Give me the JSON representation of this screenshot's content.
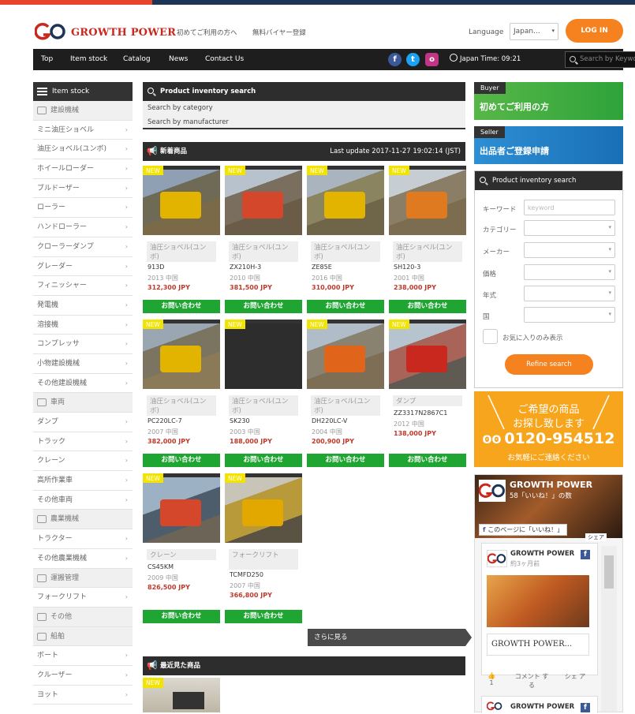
{
  "brand": {
    "name": "GROWTH POWER"
  },
  "header": {
    "links": [
      "初めてご利用の方へ",
      "無料バイヤー登録"
    ],
    "language_label": "Language",
    "language_value": "Japan...",
    "login": "LOG IN"
  },
  "nav": {
    "items": [
      "Top",
      "Item stock",
      "Catalog",
      "News",
      "Contact Us"
    ],
    "time_label": "Japan Time: 09:21",
    "search_placeholder": "Search by Keywor"
  },
  "social": [
    "f",
    "t",
    "o"
  ],
  "sidebar": {
    "title": "Item stock",
    "rows": [
      {
        "label": "建設機械",
        "type": "cat"
      },
      {
        "label": "ミニ油圧ショベル",
        "type": "item"
      },
      {
        "label": "油圧ショベル(ユンボ)",
        "type": "item"
      },
      {
        "label": "ホイールローダー",
        "type": "item"
      },
      {
        "label": "ブルドーザー",
        "type": "item"
      },
      {
        "label": "ローラー",
        "type": "item"
      },
      {
        "label": "ハンドローラー",
        "type": "item"
      },
      {
        "label": "クローラーダンプ",
        "type": "item"
      },
      {
        "label": "グレーダー",
        "type": "item"
      },
      {
        "label": "フィニッシャー",
        "type": "item"
      },
      {
        "label": "発電機",
        "type": "item"
      },
      {
        "label": "溶接機",
        "type": "item"
      },
      {
        "label": "コンプレッサ",
        "type": "item"
      },
      {
        "label": "小物建設機械",
        "type": "item"
      },
      {
        "label": "その他建設機械",
        "type": "item"
      },
      {
        "label": "車両",
        "type": "cat"
      },
      {
        "label": "ダンプ",
        "type": "item"
      },
      {
        "label": "トラック",
        "type": "item"
      },
      {
        "label": "クレーン",
        "type": "item"
      },
      {
        "label": "高所作業車",
        "type": "item"
      },
      {
        "label": "その他車両",
        "type": "item"
      },
      {
        "label": "農業機械",
        "type": "cat"
      },
      {
        "label": "トラクター",
        "type": "item"
      },
      {
        "label": "その他農業機械",
        "type": "item"
      },
      {
        "label": "運搬管理",
        "type": "cat"
      },
      {
        "label": "フォークリフト",
        "type": "item"
      },
      {
        "label": "その他",
        "type": "cat"
      },
      {
        "label": "船舶",
        "type": "cat"
      },
      {
        "label": "ボート",
        "type": "item"
      },
      {
        "label": "クルーザー",
        "type": "item"
      },
      {
        "label": "ヨット",
        "type": "item"
      }
    ]
  },
  "inventory_search": {
    "title": "Product inventory search",
    "by_category": "Search by category",
    "by_manufacturer": "Search by manufacturer"
  },
  "new_items": {
    "title": "新着商品",
    "last_update": "Last update 2017-11-27 19:02:14 (JST)",
    "badge": "NEW",
    "contact": "お問い合わせ",
    "more": "さらに見る",
    "products": [
      {
        "cat": "油圧ショベル(ユンボ)",
        "model": "913D",
        "year_country": "2013 中国",
        "price": "312,300 JPY"
      },
      {
        "cat": "油圧ショベル(ユンボ)",
        "model": "ZX210H-3",
        "year_country": "2010 中国",
        "price": "381,500 JPY"
      },
      {
        "cat": "油圧ショベル(ユンボ)",
        "model": "ZE85E",
        "year_country": "2016 中国",
        "price": "310,000 JPY"
      },
      {
        "cat": "油圧ショベル(ユンボ)",
        "model": "SH120-3",
        "year_country": "2001 中国",
        "price": "238,000 JPY"
      },
      {
        "cat": "油圧ショベル(ユンボ)",
        "model": "PC220LC-7",
        "year_country": "2007 中国",
        "price": "382,000 JPY"
      },
      {
        "cat": "油圧ショベル(ユンボ)",
        "model": "SK230",
        "year_country": "2003 中国",
        "price": "188,000 JPY"
      },
      {
        "cat": "油圧ショベル(ユンボ)",
        "model": "DH220LC-V",
        "year_country": "2004 中国",
        "price": "200,900 JPY"
      },
      {
        "cat": "ダンプ",
        "model": "ZZ3317N2867C1",
        "year_country": "2012 中国",
        "price": "138,000 JPY"
      },
      {
        "cat": "クレーン",
        "model": "CS45KM",
        "year_country": "2009 中国",
        "price": "826,500 JPY"
      },
      {
        "cat": "フォークリフト",
        "model": "TCMFD250",
        "year_country": "2007 中国",
        "price": "366,800 JPY"
      }
    ]
  },
  "recent": {
    "title": "最近見た商品",
    "badge": "NEW"
  },
  "right": {
    "buyer_tag": "Buyer",
    "buyer_text": "初めてご利用の方",
    "seller_tag": "Seller",
    "seller_text": "出品者ご登録申請",
    "search_title": "Product inventory search",
    "keyword_label": "キーワード",
    "keyword_placeholder": "keyword",
    "category_label": "カテゴリー",
    "maker_label": "メーカー",
    "price_label": "価格",
    "year_label": "年式",
    "country_label": "国",
    "favorites_label": "お気に入りのみ表示",
    "refine": "Refine search",
    "ad_line1": "ご希望の商品",
    "ad_line2": "お探し致します",
    "ad_phone": "0120-954512",
    "ad_line3": "お気軽にご連絡ください",
    "fb_page": "GROWTH POWER",
    "fb_likes": "58「いいね！」の数",
    "fb_like_btn": "このページに「いいね！」",
    "fb_share": "シェア",
    "fb_post_name": "GROWTH POWER",
    "fb_post_time": "約3ヶ月前",
    "fb_post_title": "GROWTH POWER...",
    "fb_like_count": "1",
    "fb_comment": "コメント する",
    "fb_share2": "シェ ア",
    "fb_post2_name": "GROWTH POWER"
  },
  "colors": {
    "accent": "#f5821f",
    "green": "#1fa531",
    "price": "#c0392b",
    "brand_red": "#c8281e"
  }
}
